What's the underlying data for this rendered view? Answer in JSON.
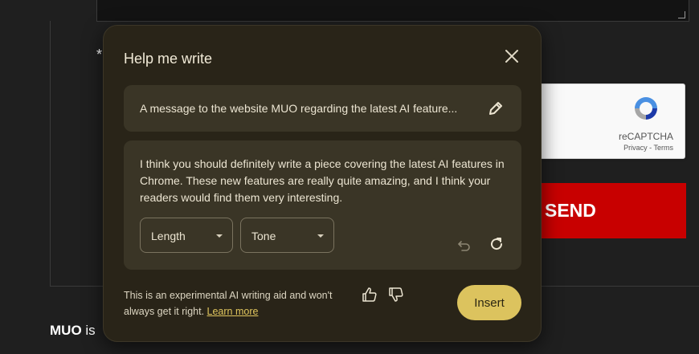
{
  "page": {
    "required_mark": "*",
    "recaptcha": {
      "name": "reCAPTCHA",
      "links": "Privacy - Terms"
    },
    "send_label": "SEND",
    "footer": {
      "brand": "MUO",
      "text": " is"
    }
  },
  "dialog": {
    "title": "Help me write",
    "prompt": "A message to the website MUO regarding the latest AI feature...",
    "response": "I think you should definitely write a piece covering the latest AI features in Chrome. These new features are really quite amazing, and I think your readers would find them very interesting.",
    "length_label": "Length",
    "tone_label": "Tone",
    "disclaimer": "This is an experimental AI writing aid and won't always get it right.",
    "learn_more": "Learn more",
    "insert_label": "Insert"
  },
  "icons": {
    "close": "close-icon",
    "edit": "pencil-icon",
    "undo": "undo-icon",
    "refresh": "refresh-icon",
    "thumb_up": "thumb-up-icon",
    "thumb_down": "thumb-down-icon",
    "recaptcha": "recaptcha-logo"
  },
  "colors": {
    "dialog_bg": "#292418",
    "panel_bg": "#3a3526",
    "accent": "#dcc35e",
    "send_bg": "#c80000",
    "page_bg": "#1f1f1f"
  }
}
